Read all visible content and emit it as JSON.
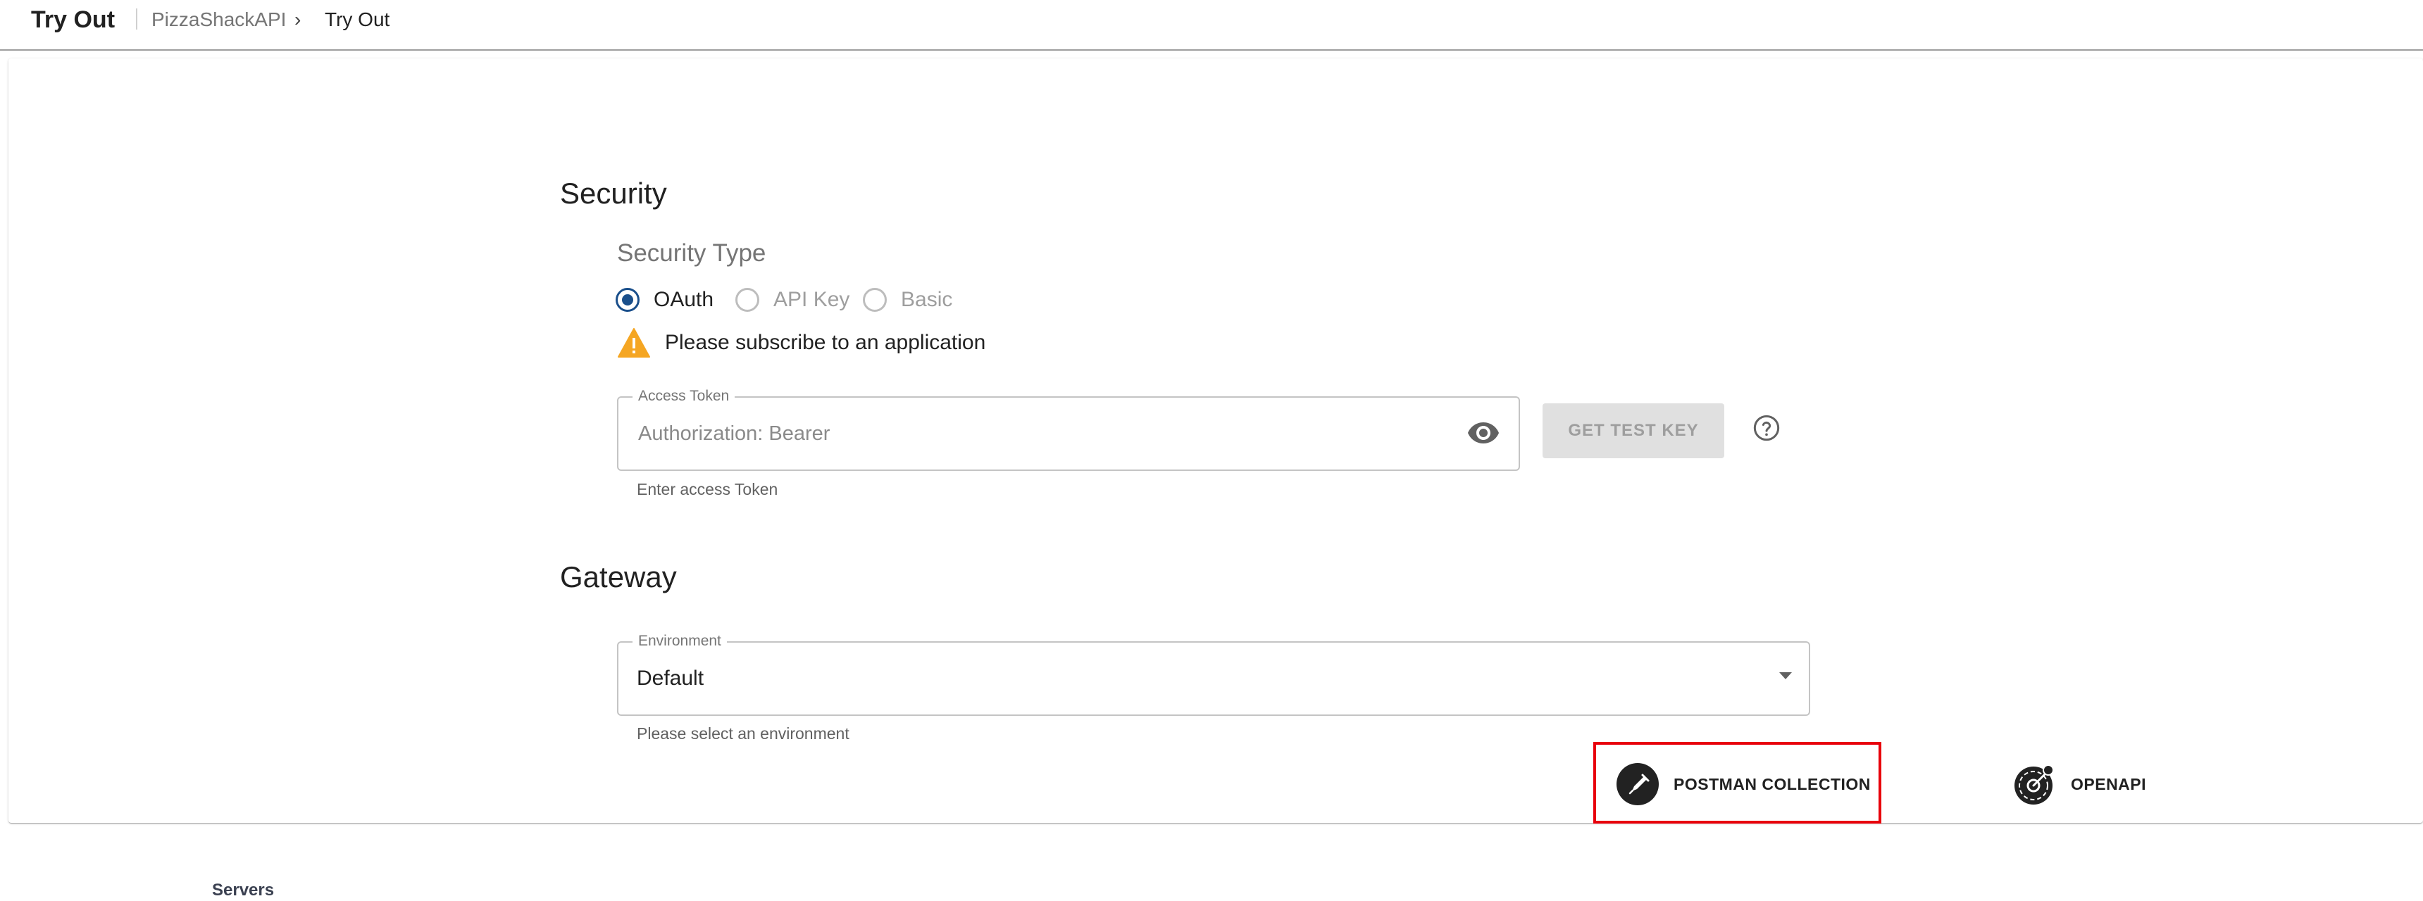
{
  "header": {
    "title": "Try Out",
    "breadcrumb": {
      "api": "PizzaShackAPI",
      "separator": "›",
      "current": "Try Out"
    }
  },
  "security": {
    "heading": "Security",
    "type_heading": "Security Type",
    "options": [
      {
        "label": "OAuth",
        "selected": true
      },
      {
        "label": "API Key",
        "selected": false
      },
      {
        "label": "Basic",
        "selected": false
      }
    ],
    "warning": "Please subscribe to an application",
    "access_token": {
      "legend": "Access Token",
      "placeholder": "Authorization: Bearer",
      "value": "",
      "helper": "Enter access Token"
    },
    "test_key_button": "GET TEST KEY"
  },
  "gateway": {
    "heading": "Gateway",
    "environment": {
      "legend": "Environment",
      "value": "Default",
      "helper": "Please select an environment"
    }
  },
  "exports": {
    "postman_label": "POSTMAN COLLECTION",
    "openapi_label": "OPENAPI"
  },
  "servers_label": "Servers",
  "colors": {
    "radio_accent": "#1a4f8b",
    "warning": "#f5a623",
    "highlight": "#e8000b"
  },
  "icons": [
    "visibility-eye-icon",
    "help-circle-icon",
    "warning-icon",
    "postman-icon",
    "openapi-icon",
    "chevron-down-icon"
  ]
}
